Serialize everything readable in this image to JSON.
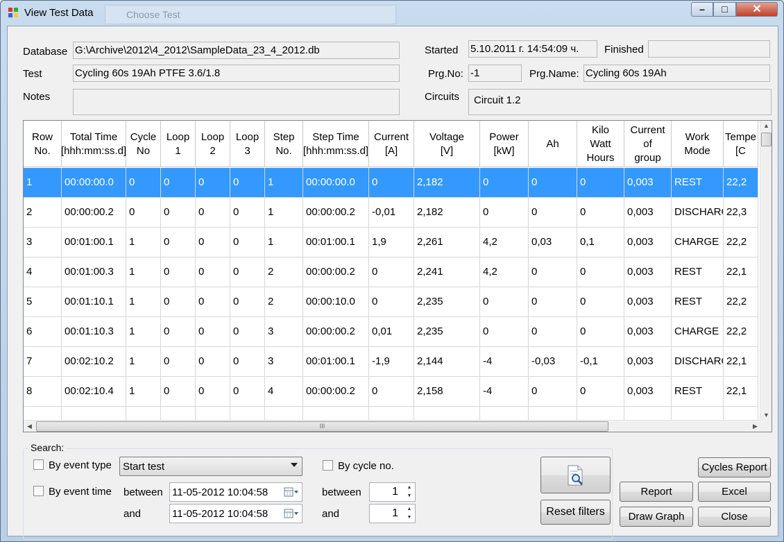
{
  "window": {
    "title": "View Test Data",
    "background_title": "Choose Test"
  },
  "info": {
    "database_label": "Database",
    "database_value": "G:\\Archive\\2012\\4_2012\\SampleData_23_4_2012.db",
    "test_label": "Test",
    "test_value": "Cycling 60s 19Ah PTFE 3.6/1.8",
    "notes_label": "Notes",
    "notes_value": "",
    "started_label": "Started",
    "started_value": "5.10.2011 г. 14:54:09 ч.",
    "finished_label": "Finished",
    "finished_value": "",
    "prgno_label": "Prg.No:",
    "prgno_value": "-1",
    "prgname_label": "Prg.Name:",
    "prgname_value": "Cycling 60s 19Ah",
    "circuits_label": "Circuits",
    "circuits_value": "Circuit 1.2"
  },
  "grid": {
    "columns": [
      "Row\nNo.",
      "Total Time\n[hhh:mm:ss.d]",
      "Cycle\nNo",
      "Loop\n1",
      "Loop\n2",
      "Loop\n3",
      "Step\nNo.",
      "Step Time\n[hhh:mm:ss.d]",
      "Current\n[A]",
      "Voltage\n[V]",
      "Power\n[kW]",
      "Ah",
      "Kilo\nWatt\nHours",
      "Current\nof\ngroup",
      "Work\nMode",
      "Tempe\n[C"
    ],
    "rows": [
      [
        "1",
        "00:00:00.0",
        "0",
        "0",
        "0",
        "0",
        "1",
        "00:00:00.0",
        "0",
        "2,182",
        "0",
        "0",
        "0",
        "0,003",
        "REST",
        "22,2"
      ],
      [
        "2",
        "00:00:00.2",
        "0",
        "0",
        "0",
        "0",
        "1",
        "00:00:00.2",
        "-0,01",
        "2,182",
        "0",
        "0",
        "0",
        "0,003",
        "DISCHARG",
        "22,3"
      ],
      [
        "3",
        "00:01:00.1",
        "1",
        "0",
        "0",
        "0",
        "1",
        "00:01:00.1",
        "1,9",
        "2,261",
        "4,2",
        "0,03",
        "0,1",
        "0,003",
        "CHARGE",
        "22,2"
      ],
      [
        "4",
        "00:01:00.3",
        "1",
        "0",
        "0",
        "0",
        "2",
        "00:00:00.2",
        "0",
        "2,241",
        "4,2",
        "0",
        "0",
        "0,003",
        "REST",
        "22,1"
      ],
      [
        "5",
        "00:01:10.1",
        "1",
        "0",
        "0",
        "0",
        "2",
        "00:00:10.0",
        "0",
        "2,235",
        "0",
        "0",
        "0",
        "0,003",
        "REST",
        "22,2"
      ],
      [
        "6",
        "00:01:10.3",
        "1",
        "0",
        "0",
        "0",
        "3",
        "00:00:00.2",
        "0,01",
        "2,235",
        "0",
        "0",
        "0",
        "0,003",
        "CHARGE",
        "22,2"
      ],
      [
        "7",
        "00:02:10.2",
        "1",
        "0",
        "0",
        "0",
        "3",
        "00:01:00.1",
        "-1,9",
        "2,144",
        "-4",
        "-0,03",
        "-0,1",
        "0,003",
        "DISCHARG",
        "22,1"
      ],
      [
        "8",
        "00:02:10.4",
        "1",
        "0",
        "0",
        "0",
        "4",
        "00:00:00.2",
        "0",
        "2,158",
        "-4",
        "0",
        "0",
        "0,003",
        "REST",
        "22,1"
      ]
    ],
    "selected_row": 0,
    "hscroll_grip": "III"
  },
  "search": {
    "group_label": "Search:",
    "by_event_type": "By event type",
    "event_type_selected": "Start test",
    "by_event_time": "By event time",
    "between": "between",
    "and": "and",
    "date_from": "11-05-2012 10:04:58",
    "date_to": "11-05-2012 10:04:58",
    "by_cycle_no": "By cycle no.",
    "cycle_between": "between",
    "cycle_and": "and",
    "cycle_from": "1",
    "cycle_to": "1"
  },
  "buttons": {
    "reset_filters": "Reset filters",
    "cycles_report": "Cycles Report",
    "report": "Report",
    "excel": "Excel",
    "draw_graph": "Draw Graph",
    "close": "Close"
  },
  "colors": {
    "selection": "#3399ff",
    "window_frame": "#b9cfe6",
    "close_button": "#c2412a"
  }
}
